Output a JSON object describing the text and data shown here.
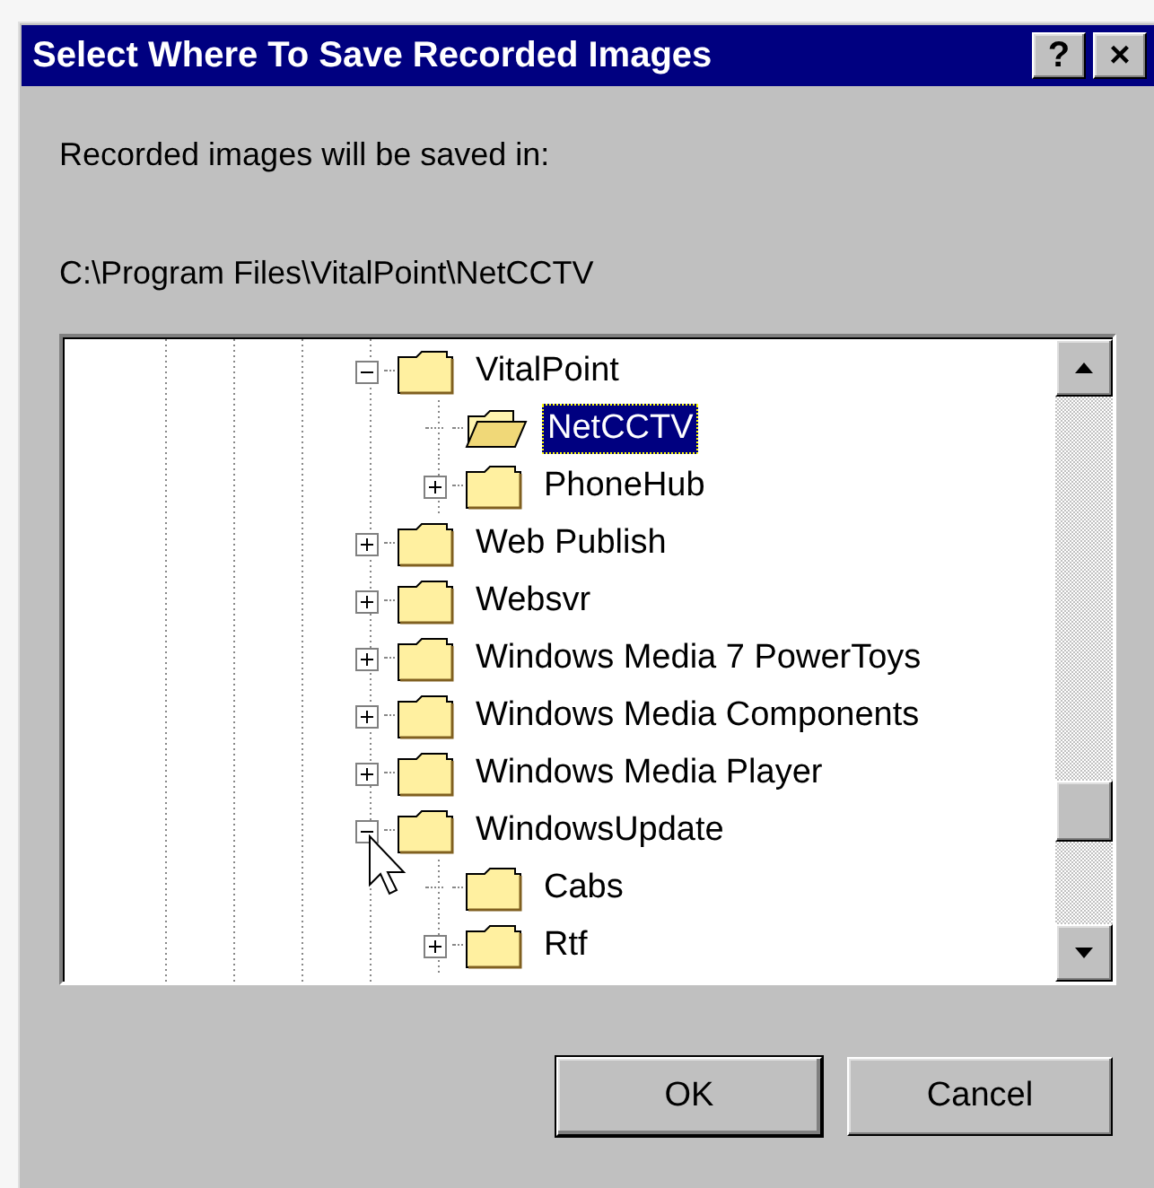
{
  "window": {
    "title": "Select Where To Save Recorded Images",
    "title_buttons": [
      "?",
      "×"
    ]
  },
  "label": "Recorded images will be saved in:",
  "path": "C:\\Program Files\\VitalPoint\\NetCCTV",
  "tree": {
    "items": [
      {
        "label": "VitalPoint",
        "kind": "branch",
        "expanded": true,
        "selected": false,
        "children": [
          {
            "label": "NetCCTV",
            "kind": "leaf",
            "selected": true
          },
          {
            "label": "PhoneHub",
            "kind": "branch",
            "expanded": false,
            "selected": false
          }
        ]
      },
      {
        "label": "Web Publish",
        "kind": "branch",
        "expanded": false,
        "selected": false
      },
      {
        "label": "Websvr",
        "kind": "branch",
        "expanded": false,
        "selected": false
      },
      {
        "label": "Windows Media 7 PowerToys",
        "kind": "branch",
        "expanded": false,
        "selected": false
      },
      {
        "label": "Windows Media Components",
        "kind": "branch",
        "expanded": false,
        "selected": false
      },
      {
        "label": "Windows Media Player",
        "kind": "branch",
        "expanded": false,
        "selected": false
      },
      {
        "label": "WindowsUpdate",
        "kind": "branch",
        "expanded": true,
        "selected": false,
        "children": [
          {
            "label": "Cabs",
            "kind": "leaf",
            "selected": false
          },
          {
            "label": "Rtf",
            "kind": "branch",
            "expanded": false,
            "selected": false
          }
        ]
      }
    ]
  },
  "buttons": [
    {
      "label": "OK",
      "default": true
    },
    {
      "label": "Cancel",
      "default": false
    }
  ]
}
